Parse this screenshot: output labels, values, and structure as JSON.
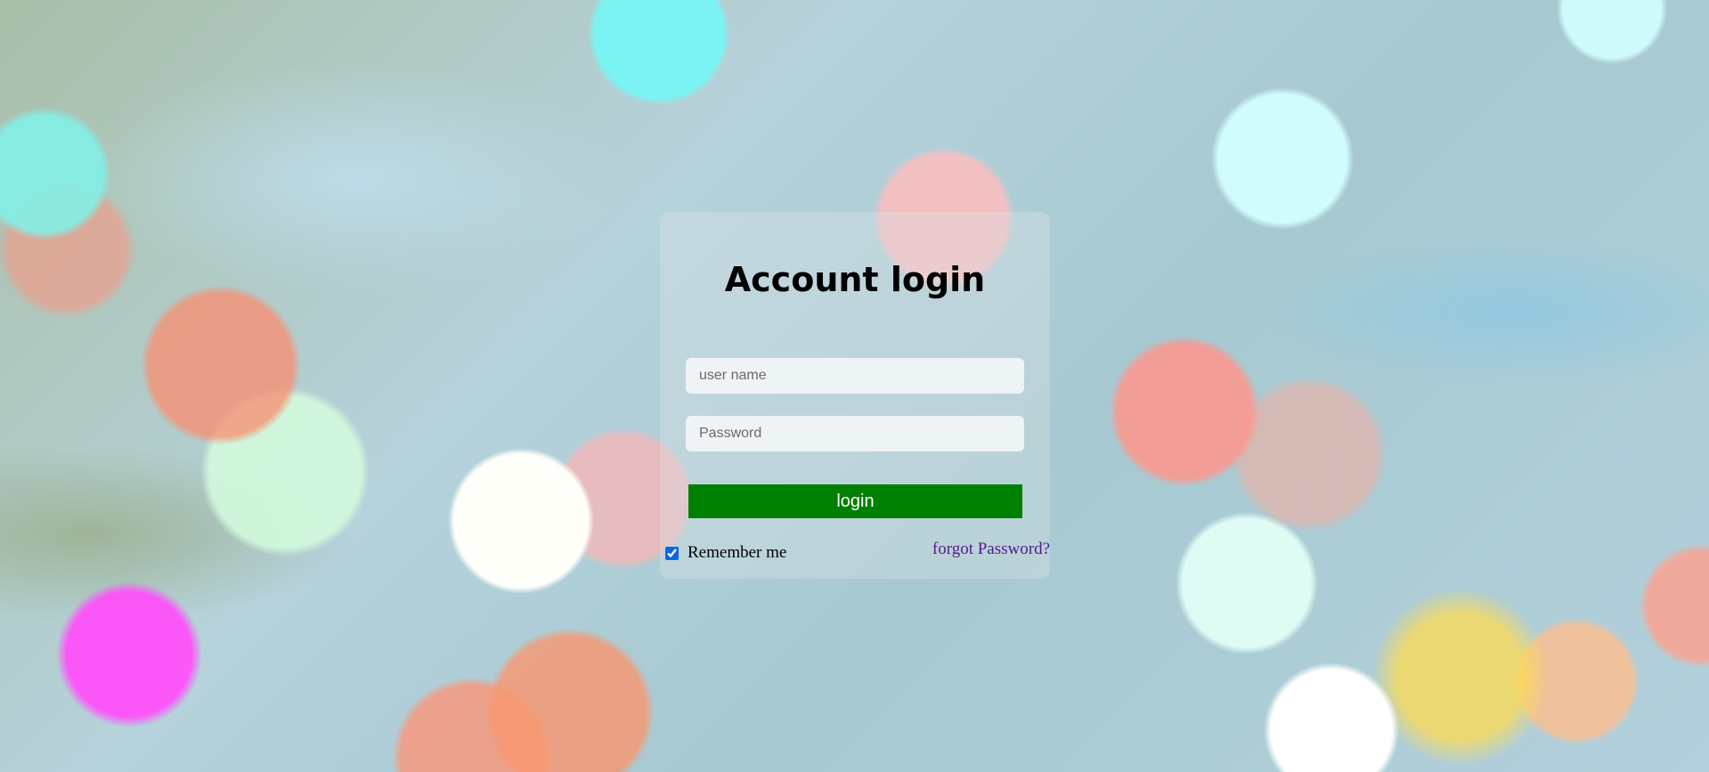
{
  "login_form": {
    "title": "Account login",
    "username_placeholder": "user name",
    "password_placeholder": "Password",
    "login_label": "login",
    "remember_label": "Remember me",
    "remember_checked": true,
    "forgot_label": "forgot Password?"
  },
  "colors": {
    "button": "#008000",
    "link": "#551a8b"
  }
}
